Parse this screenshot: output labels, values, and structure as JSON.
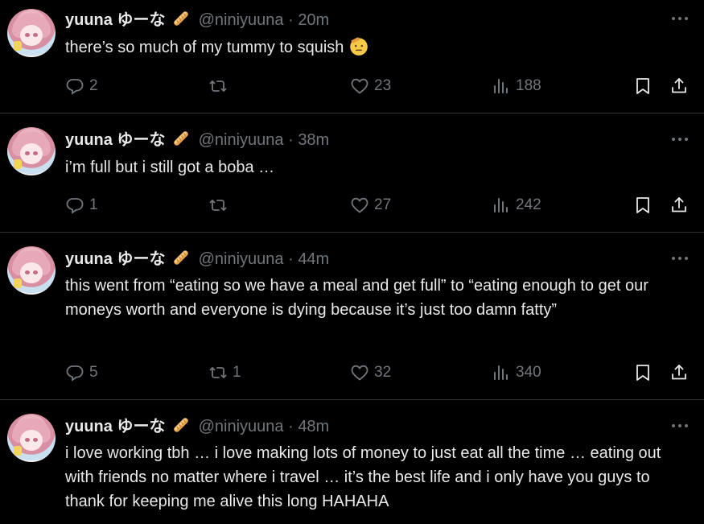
{
  "tweets": [
    {
      "name": "yuuna ゆーな",
      "handle": "@niniyuuna",
      "separator": "·",
      "time": "20m",
      "text": "there’s so much of my tummy to squish",
      "replies": "2",
      "reposts": "",
      "likes": "23",
      "views": "188"
    },
    {
      "name": "yuuna ゆーな",
      "handle": "@niniyuuna",
      "separator": "·",
      "time": "38m",
      "text": "i’m full but i still got a boba …",
      "replies": "1",
      "reposts": "",
      "likes": "27",
      "views": "242"
    },
    {
      "name": "yuuna ゆーな",
      "handle": "@niniyuuna",
      "separator": "·",
      "time": "44m",
      "text": "this went from “eating so we have a meal and get full” to “eating enough to get our moneys worth and everyone is dying because it’s just too damn fatty”",
      "replies": "5",
      "reposts": "1",
      "likes": "32",
      "views": "340"
    },
    {
      "name": "yuuna ゆーな",
      "handle": "@niniyuuna",
      "separator": "·",
      "time": "48m",
      "text": "i love working tbh … i love making lots of money to just eat all the time … eating out with friends no matter where i travel … it’s the best life and i only have you guys to thank for keeping me alive this long HAHAHA",
      "replies": "",
      "reposts": "",
      "likes": "",
      "views": ""
    }
  ],
  "icons": {
    "name_emoji": "baguette-emoji-icon",
    "tweet1_emoji": "saluting-face-emoji-icon",
    "more": "more-dots-icon",
    "reply": "reply-icon",
    "repost": "repost-icon",
    "like": "heart-icon",
    "views": "views-bar-chart-icon",
    "bookmark": "bookmark-icon",
    "share": "share-icon"
  },
  "colors": {
    "background": "#000000",
    "text": "#e7e9ea",
    "muted": "#71767b",
    "divider": "#2f3336"
  }
}
